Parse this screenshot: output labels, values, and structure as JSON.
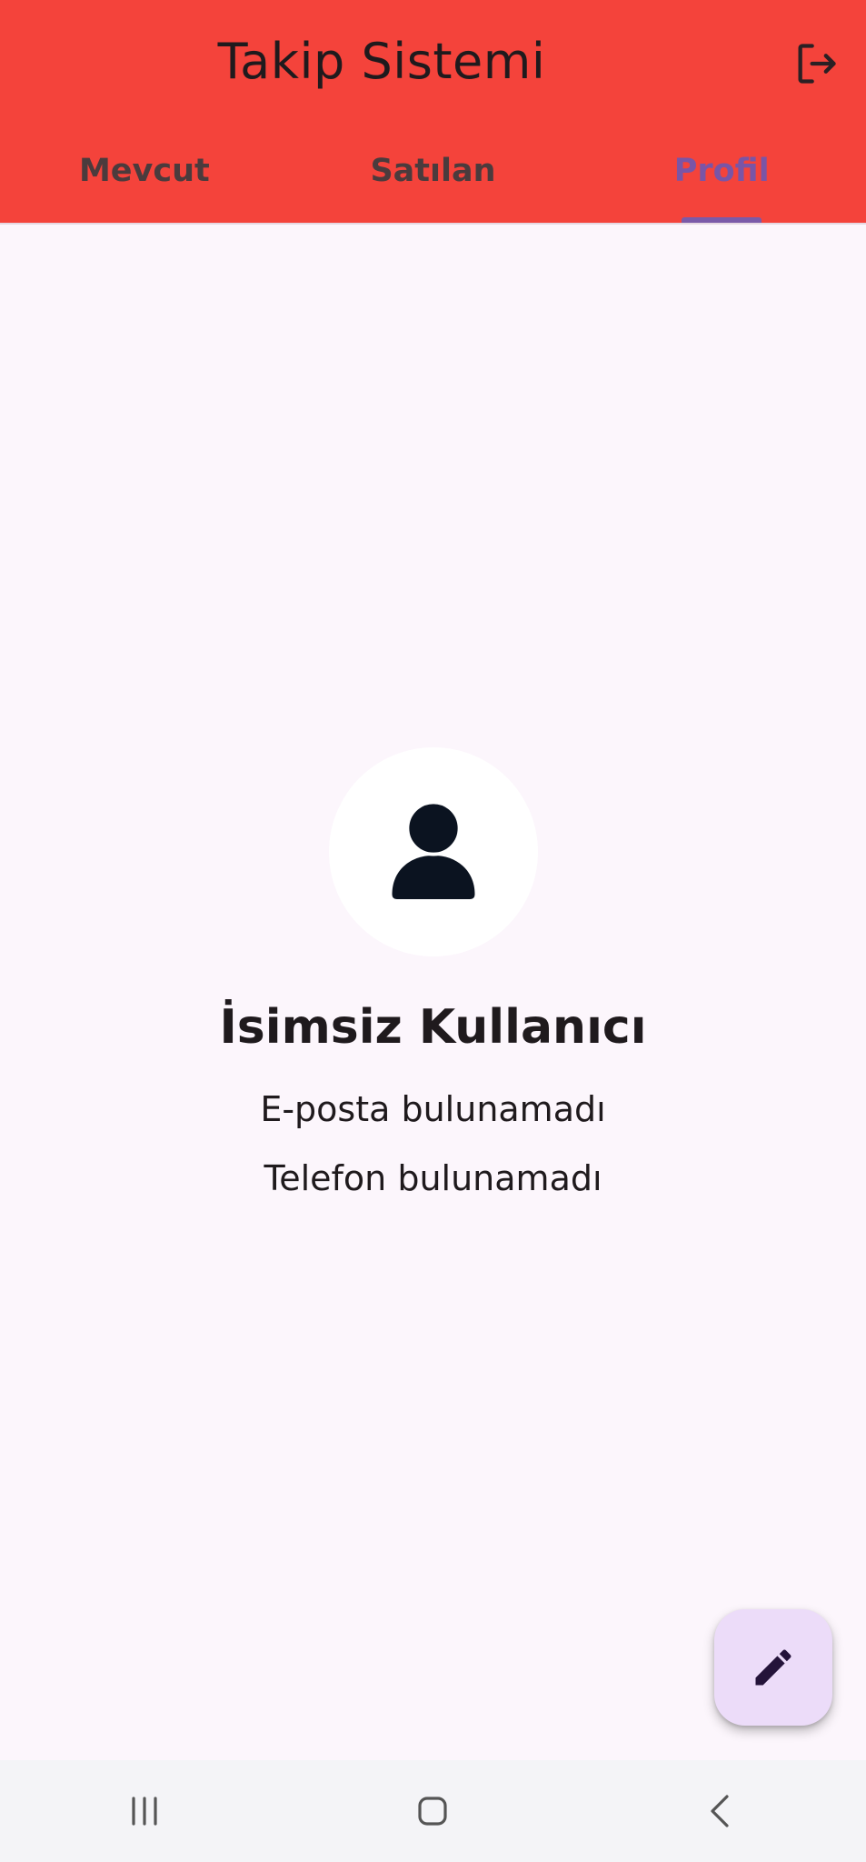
{
  "app_bar": {
    "title": "Takip Sistemi",
    "logout_icon": "logout-icon",
    "background_color": "#f4433b"
  },
  "tabs": [
    {
      "label": "Mevcut",
      "active": false
    },
    {
      "label": "Satılan",
      "active": false
    },
    {
      "label": "Profil",
      "active": true
    }
  ],
  "profile": {
    "avatar_icon": "person-icon",
    "name": "İsimsiz Kullanıcı",
    "email": "E-posta bulunamadı",
    "phone": "Telefon bulunamadı"
  },
  "fab": {
    "icon": "edit-pencil-icon",
    "background_color": "#ecdcf9"
  },
  "system_nav": {
    "recents_icon": "recents-icon",
    "home_icon": "home-icon",
    "back_icon": "back-icon"
  },
  "colors": {
    "accent": "#7b5aa8",
    "page_background": "#fcf6fc",
    "text": "#1f1a1d"
  }
}
